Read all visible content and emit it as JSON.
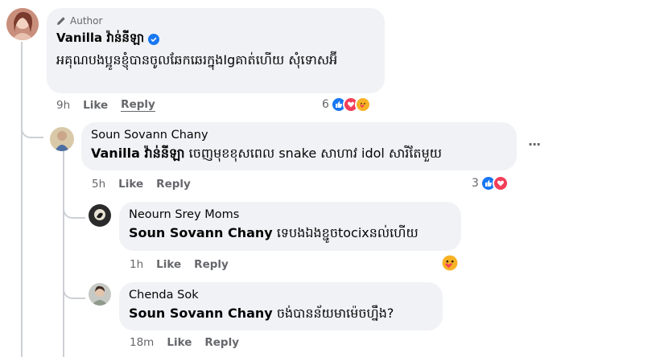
{
  "comments": [
    {
      "author_badge": "Author",
      "author": "Vanilla វ៉ាន់នីឡា",
      "verified": true,
      "text": "អគុណបងប្អូនខ្ញុំបានចូលឆែកឆេរក្នុងIgគាត់ហើយ សុំទោសអ៊ី",
      "time": "9h",
      "like_label": "Like",
      "reply_label": "Reply",
      "reaction_count": "6",
      "reactions": [
        "like-icon",
        "love-icon",
        "care-icon"
      ]
    },
    {
      "author": "Soun Sovann Chany",
      "mention": "Vanilla វ៉ាន់នីឡា",
      "text": "ចេញមុខខុសពេល snake សាហាវ idol សារីតែមួយ",
      "time": "5h",
      "like_label": "Like",
      "reply_label": "Reply",
      "reaction_count": "3",
      "reactions": [
        "like-icon",
        "love-icon"
      ],
      "more": "···"
    },
    {
      "author": "Neourn Srey Moms",
      "mention": "Soun Sovann Chany",
      "text": "ទេបងឯងខ្ជូចtocixនល់ហើយ",
      "time": "1h",
      "like_label": "Like",
      "reply_label": "Reply",
      "reactions": [
        "care-icon"
      ]
    },
    {
      "author": "Chenda Sok",
      "mention": "Soun Sovann Chany",
      "text": "ចង់បានន័យមាម៉េចហ្នឹង?",
      "time": "18m",
      "like_label": "Like",
      "reply_label": "Reply"
    }
  ],
  "colors": {
    "bubble": "#f0f2f5",
    "meta": "#65676b",
    "like": "#1877f2",
    "love": "#f33e58",
    "care": "#f7b125",
    "verified": "#1877f2"
  }
}
